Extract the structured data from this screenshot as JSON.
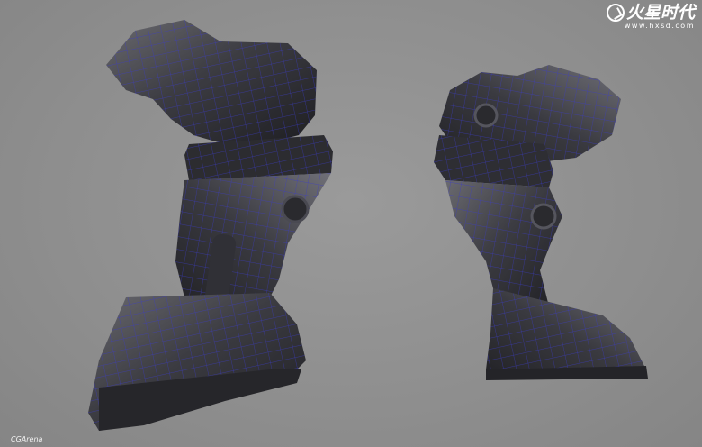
{
  "watermark": {
    "title": "火星时代",
    "url": "www.hxsd.com"
  },
  "credit": "CGArena",
  "colors": {
    "background": "#8f8f8f",
    "mesh_surface": "#3a3a3e",
    "wireframe": "#3b3bc8"
  },
  "icons": {
    "logo": "hxsd-logo-icon"
  }
}
